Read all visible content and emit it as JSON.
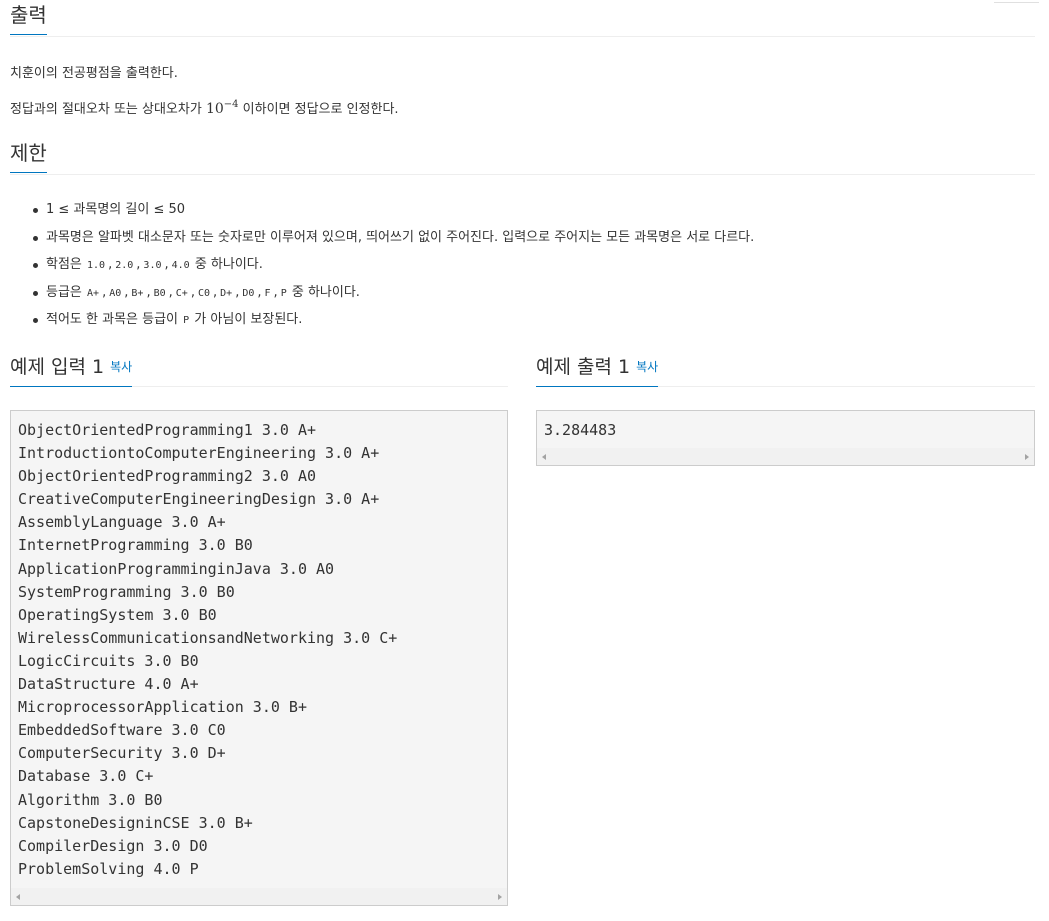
{
  "output_section": {
    "title": "출력",
    "paragraphs": {
      "p1": "치훈이의 전공평점을 출력한다.",
      "p2_before": "정답과의 절대오차 또는 상대오차가 ",
      "p2_math_base": "10",
      "p2_math_exp": "−4",
      "p2_after": " 이하이면 정답으로 인정한다."
    }
  },
  "limits_section": {
    "title": "제한",
    "item1": "1 ≤ 과목명의 길이 ≤ 50",
    "item2": "과목명은 알파벳 대소문자 또는 숫자로만 이루어져 있으며, 띄어쓰기 없이 주어진다. 입력으로 주어지는 모든 과목명은 서로 다르다.",
    "item3": {
      "prefix": "학점은 ",
      "codes": [
        "1.0",
        "2.0",
        "3.0",
        "4.0"
      ],
      "suffix": " 중 하나이다."
    },
    "item4": {
      "prefix": "등급은 ",
      "codes": [
        "A+",
        "A0",
        "B+",
        "B0",
        "C+",
        "C0",
        "D+",
        "D0",
        "F",
        "P"
      ],
      "suffix": " 중 하나이다."
    },
    "item5": {
      "prefix": "적어도 한 과목은 등급이 ",
      "code": "P",
      "suffix": " 가 아님이 보장된다."
    },
    "separator": ","
  },
  "sample_input": {
    "title": "예제 입력 1",
    "copy_label": "복사",
    "content": "ObjectOrientedProgramming1 3.0 A+\nIntroductiontoComputerEngineering 3.0 A+\nObjectOrientedProgramming2 3.0 A0\nCreativeComputerEngineeringDesign 3.0 A+\nAssemblyLanguage 3.0 A+\nInternetProgramming 3.0 B0\nApplicationProgramminginJava 3.0 A0\nSystemProgramming 3.0 B0\nOperatingSystem 3.0 B0\nWirelessCommunicationsandNetworking 3.0 C+\nLogicCircuits 3.0 B0\nDataStructure 4.0 A+\nMicroprocessorApplication 3.0 B+\nEmbeddedSoftware 3.0 C0\nComputerSecurity 3.0 D+\nDatabase 3.0 C+\nAlgorithm 3.0 B0\nCapstoneDesigninCSE 3.0 B+\nCompilerDesign 3.0 D0\nProblemSolving 4.0 P"
  },
  "sample_output": {
    "title": "예제 출력 1",
    "copy_label": "복사",
    "content": "3.284483"
  },
  "colors": {
    "accent": "#0076c0",
    "text": "#333333",
    "pre_background": "#f5f5f5"
  }
}
